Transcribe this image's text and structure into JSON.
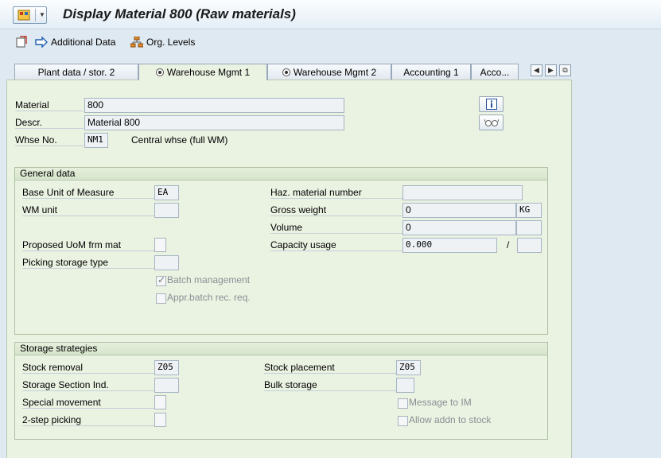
{
  "title": "Display Material 800 (Raw materials)",
  "toolbar": {
    "additional_data": "Additional Data",
    "org_levels": "Org. Levels"
  },
  "tabs": [
    {
      "label": "Plant data / stor. 2"
    },
    {
      "label": "Warehouse Mgmt 1"
    },
    {
      "label": "Warehouse Mgmt 2"
    },
    {
      "label": "Accounting 1"
    },
    {
      "label": "Acco..."
    }
  ],
  "header": {
    "material_label": "Material",
    "material_value": "800",
    "descr_label": "Descr.",
    "descr_value": "Material 800",
    "whse_label": "Whse No.",
    "whse_value": "NM1",
    "whse_desc": "Central whse (full WM)"
  },
  "general": {
    "title": "General data",
    "base_uom_label": "Base Unit of Measure",
    "base_uom_value": "EA",
    "wm_unit_label": "WM unit",
    "wm_unit_value": "",
    "prop_uom_label": "Proposed UoM frm mat",
    "picking_type_label": "Picking storage type",
    "picking_type_value": "",
    "batch_mgmt_label": "Batch management",
    "appr_batch_label": "Appr.batch rec. req.",
    "haz_label": "Haz. material number",
    "haz_value": "",
    "gross_weight_label": "Gross weight",
    "gross_weight_value": "0",
    "weight_unit": "KG",
    "volume_label": "Volume",
    "volume_value": "0",
    "volume_unit": "",
    "capacity_label": "Capacity usage",
    "capacity_value": "0.000",
    "capacity_sep": "/",
    "capacity_unit": ""
  },
  "storage": {
    "title": "Storage strategies",
    "stock_removal_label": "Stock removal",
    "stock_removal_value": "Z05",
    "section_label": "Storage Section Ind.",
    "section_value": "",
    "special_label": "Special movement",
    "two_step_label": "2-step picking",
    "placement_label": "Stock placement",
    "placement_value": "Z05",
    "bulk_label": "Bulk storage",
    "bulk_value": "",
    "message_im_label": "Message to IM",
    "addn_stock_label": "Allow addn to stock"
  }
}
